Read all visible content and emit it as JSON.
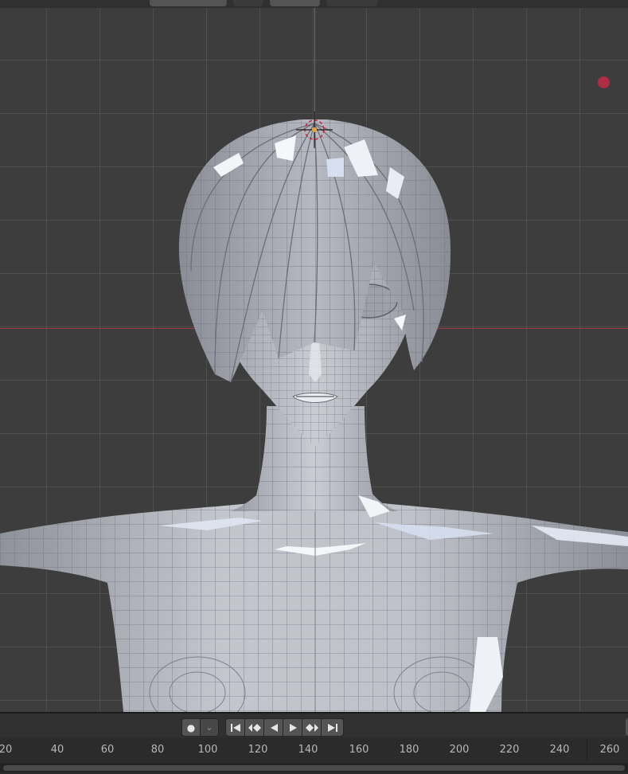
{
  "app": {
    "name": "3D viewport with timeline"
  },
  "viewport": {
    "axis_colors": {
      "x": "#9b3a44",
      "z": "#3b6fbf"
    },
    "record_indicator_color": "#b12c45",
    "mesh_color": "#b9bcc4"
  },
  "header": {
    "icons": [
      "viewport-shading-icon",
      "overlay-icon",
      "snap-icon",
      "proportional-edit-icon"
    ]
  },
  "timeline": {
    "controls": {
      "record": "●",
      "record_dropdown": "⌄",
      "jump_start": "jump-to-start-icon",
      "prev_keyframe": "previous-keyframe-icon",
      "play_reverse": "play-reverse-icon",
      "play": "play-icon",
      "next_keyframe": "next-keyframe-icon",
      "jump_end": "jump-to-end-icon"
    },
    "ruler_labels": [
      "20",
      "40",
      "60",
      "80",
      "100",
      "120",
      "140",
      "160",
      "180",
      "200",
      "220",
      "240",
      "260"
    ]
  }
}
